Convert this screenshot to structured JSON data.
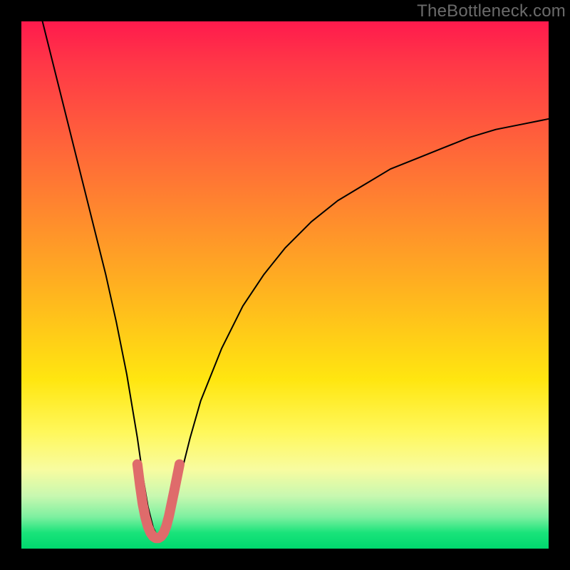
{
  "watermark": {
    "text": "TheBottleneck.com"
  },
  "chart_data": {
    "type": "line",
    "title": "",
    "xlabel": "",
    "ylabel": "",
    "xlim": [
      0,
      100
    ],
    "ylim": [
      0,
      100
    ],
    "grid": false,
    "legend": null,
    "series": [
      {
        "name": "bottleneck-curve",
        "color": "#000000",
        "x": [
          4,
          6,
          8,
          10,
          12,
          14,
          16,
          18,
          20,
          21,
          22,
          23,
          24,
          25,
          26,
          27,
          28,
          29,
          30,
          32,
          34,
          38,
          42,
          46,
          50,
          55,
          60,
          65,
          70,
          75,
          80,
          85,
          90,
          95,
          100
        ],
        "y": [
          100,
          92,
          84,
          76,
          68,
          60,
          52,
          43,
          33,
          27,
          21,
          14,
          8,
          4,
          2,
          2,
          4,
          8,
          13,
          21,
          28,
          38,
          46,
          52,
          57,
          62,
          66,
          69,
          72,
          74,
          76,
          78,
          79.5,
          80.5,
          81.5
        ]
      },
      {
        "name": "highlight-segment",
        "color": "#e06a6a",
        "thick": true,
        "x": [
          22.0,
          22.5,
          23.0,
          23.5,
          24.0,
          24.5,
          25.0,
          25.5,
          26.0,
          26.5,
          27.0,
          27.5,
          28.0,
          28.5,
          29.0,
          29.5,
          30.0
        ],
        "y": [
          16.0,
          12.0,
          8.5,
          6.0,
          4.2,
          3.0,
          2.3,
          2.0,
          2.0,
          2.3,
          3.0,
          4.3,
          6.2,
          8.6,
          11.0,
          13.5,
          16.0
        ]
      }
    ],
    "annotations": []
  }
}
